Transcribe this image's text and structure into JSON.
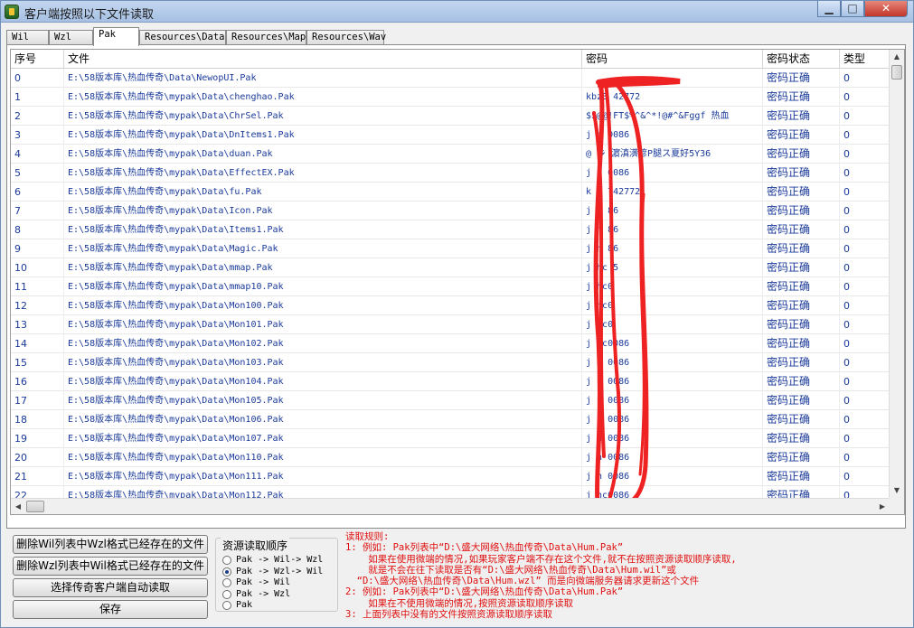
{
  "window": {
    "title": "客户端按照以下文件读取",
    "minimize": "▁",
    "maximize": "□",
    "close": "✕"
  },
  "tabs": [
    "Wil",
    "Wzl",
    "Pak",
    "Resources\\Data",
    "Resources\\Map",
    "Resources\\Wav"
  ],
  "active_tab": "Pak",
  "table": {
    "columns": [
      "序号",
      "文件",
      "密码",
      "密码状态",
      "类型"
    ],
    "rows": [
      [
        "0",
        "E:\\58版本库\\热血传奇\\Data\\NewopUI.Pak",
        "",
        "密码正确",
        "0"
      ],
      [
        "1",
        "E:\\58版本库\\热血传奇\\mypak\\Data\\chenghao.Pak",
        "kbz3 42772",
        "密码正确",
        "0"
      ],
      [
        "2",
        "E:\\58版本库\\热血传奇\\mypak\\Data\\ChrSel.Pak",
        "$$@@!FT$%^&^*!@#^&Fggf   热血",
        "密码正确",
        "0"
      ],
      [
        "3",
        "E:\\58版本库\\热血传奇\\mypak\\Data\\DnItems1.Pak",
        "j h 0086",
        "密码正确",
        "0"
      ],
      [
        "4",
        "E:\\58版本库\\热血传奇\\mypak\\Data\\duan.Pak",
        "@ 乡 濵滇潢谚P腿ス夏好5Y36",
        "密码正确",
        "0"
      ],
      [
        "5",
        "E:\\58版本库\\热血传奇\\mypak\\Data\\EffectEX.Pak",
        "j h 0086",
        "密码正确",
        "0"
      ],
      [
        "6",
        "E:\\58版本库\\热血传奇\\mypak\\Data\\fu.Pak",
        "k z 742772",
        "密码正确",
        "0"
      ],
      [
        "7",
        "E:\\58版本库\\热血传奇\\mypak\\Data\\Icon.Pak",
        "j h 86",
        "密码正确",
        "0"
      ],
      [
        "8",
        "E:\\58版本库\\热血传奇\\mypak\\Data\\Items1.Pak",
        "j h 86",
        "密码正确",
        "0"
      ],
      [
        "9",
        "E:\\58版本库\\热血传奇\\mypak\\Data\\Magic.Pak",
        "j h 86",
        "密码正确",
        "0"
      ],
      [
        "10",
        "E:\\58版本库\\热血传奇\\mypak\\Data\\mmap.Pak",
        "j hc 5",
        "密码正确",
        "0"
      ],
      [
        "11",
        "E:\\58版本库\\热血传奇\\mypak\\Data\\mmap10.Pak",
        "j hc0",
        "密码正确",
        "0"
      ],
      [
        "12",
        "E:\\58版本库\\热血传奇\\mypak\\Data\\Mon100.Pak",
        "j hc0",
        "密码正确",
        "0"
      ],
      [
        "13",
        "E:\\58版本库\\热血传奇\\mypak\\Data\\Mon101.Pak",
        "j hc0",
        "密码正确",
        "0"
      ],
      [
        "14",
        "E:\\58版本库\\热血传奇\\mypak\\Data\\Mon102.Pak",
        "j hc0086",
        "密码正确",
        "0"
      ],
      [
        "15",
        "E:\\58版本库\\热血传奇\\mypak\\Data\\Mon103.Pak",
        "j h 0086",
        "密码正确",
        "0"
      ],
      [
        "16",
        "E:\\58版本库\\热血传奇\\mypak\\Data\\Mon104.Pak",
        "j h 0086",
        "密码正确",
        "0"
      ],
      [
        "17",
        "E:\\58版本库\\热血传奇\\mypak\\Data\\Mon105.Pak",
        "j h 0086",
        "密码正确",
        "0"
      ],
      [
        "18",
        "E:\\58版本库\\热血传奇\\mypak\\Data\\Mon106.Pak",
        "j h 0086",
        "密码正确",
        "0"
      ],
      [
        "19",
        "E:\\58版本库\\热血传奇\\mypak\\Data\\Mon107.Pak",
        "j h 0086",
        "密码正确",
        "0"
      ],
      [
        "20",
        "E:\\58版本库\\热血传奇\\mypak\\Data\\Mon110.Pak",
        "j h 0086",
        "密码正确",
        "0"
      ],
      [
        "21",
        "E:\\58版本库\\热血传奇\\mypak\\Data\\Mon111.Pak",
        "j h 0086",
        "密码正确",
        "0"
      ],
      [
        "22",
        "E:\\58版本库\\热血传奇\\mypak\\Data\\Mon112.Pak",
        "j hc0086",
        "密码正确",
        "0"
      ]
    ]
  },
  "buttons": {
    "delete_wil": "删除Wil列表中Wzl格式已经存在的文件",
    "delete_wzl": "删除Wzl列表中Wil格式已经存在的文件",
    "auto_read": "选择传奇客户端自动读取",
    "save": "保存"
  },
  "resource_order": {
    "title": "资源读取顺序",
    "options": [
      "Pak -> Wil-> Wzl",
      "Pak -> Wzl-> Wil",
      "Pak -> Wil",
      "Pak -> Wzl",
      "Pak"
    ],
    "selected_index": 1
  },
  "rules": {
    "lines": [
      "读取规则:",
      "1: 例如: Pak列表中“D:\\盛大网络\\热血传奇\\Data\\Hum.Pak”",
      "    如果在使用微端的情况,如果玩家客户端不存在这个文件,就不在按照资源读取顺序读取,",
      "    就是不会在往下读取是否有“D:\\盛大网络\\热血传奇\\Data\\Hum.wil”或",
      "  “D:\\盛大网络\\热血传奇\\Data\\Hum.wzl” 而是向微端服务器请求更新这个文件",
      "2: 例如: Pak列表中“D:\\盛大网络\\热血传奇\\Data\\Hum.Pak”",
      "    如果在不使用微端的情况,按照资源读取顺序读取",
      "3: 上面列表中没有的文件按照资源读取顺序读取"
    ]
  },
  "colors": {
    "redaction": "#ee2222",
    "rules_text": "#e01010",
    "cell_text": "#1a3a9a"
  }
}
